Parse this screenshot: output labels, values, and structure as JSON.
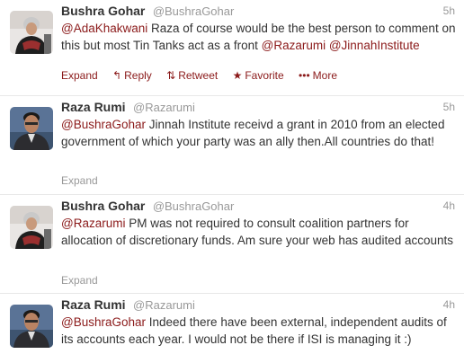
{
  "tweets": [
    {
      "fullname": "Bushra Gohar",
      "username": "@BushraGohar",
      "time": "5h",
      "segments": [
        {
          "type": "mention",
          "text": "@AdaKhakwani"
        },
        {
          "type": "text",
          "text": " Raza of course would be the best person to comment on this but most Tin Tanks act as a front "
        },
        {
          "type": "mention",
          "text": "@Razarumi"
        },
        {
          "type": "text",
          "text": " "
        },
        {
          "type": "mention",
          "text": "@JinnahInstitute"
        }
      ],
      "actions": {
        "expand": "Expand",
        "reply": "Reply",
        "retweet": "Retweet",
        "favorite": "Favorite",
        "more": "More"
      }
    },
    {
      "fullname": "Raza Rumi",
      "username": "@Razarumi",
      "time": "5h",
      "segments": [
        {
          "type": "mention",
          "text": "@BushraGohar"
        },
        {
          "type": "text",
          "text": " Jinnah Institute receivd a grant in 2010 from an elected government of which your party was an ally then.All countries do that!"
        }
      ],
      "actions": {
        "expand": "Expand"
      }
    },
    {
      "fullname": "Bushra Gohar",
      "username": "@BushraGohar",
      "time": "4h",
      "segments": [
        {
          "type": "mention",
          "text": "@Razarumi"
        },
        {
          "type": "text",
          "text": " PM was not required to consult coalition partners for allocation of discretionary funds. Am sure your web has audited accounts"
        }
      ],
      "actions": {
        "expand": "Expand"
      }
    },
    {
      "fullname": "Raza Rumi",
      "username": "@Razarumi",
      "time": "4h",
      "segments": [
        {
          "type": "mention",
          "text": "@BushraGohar"
        },
        {
          "type": "text",
          "text": " Indeed there have been external, independent audits of its accounts each year. I would not be there if ISI is managing it :)"
        }
      ],
      "actions": {}
    }
  ],
  "colors": {
    "mention": "#8b1a1a",
    "muted": "#999999",
    "text": "#333333"
  },
  "icons": {
    "reply": "reply-icon",
    "retweet": "retweet-icon",
    "favorite": "star-icon",
    "more": "more-dots-icon"
  }
}
